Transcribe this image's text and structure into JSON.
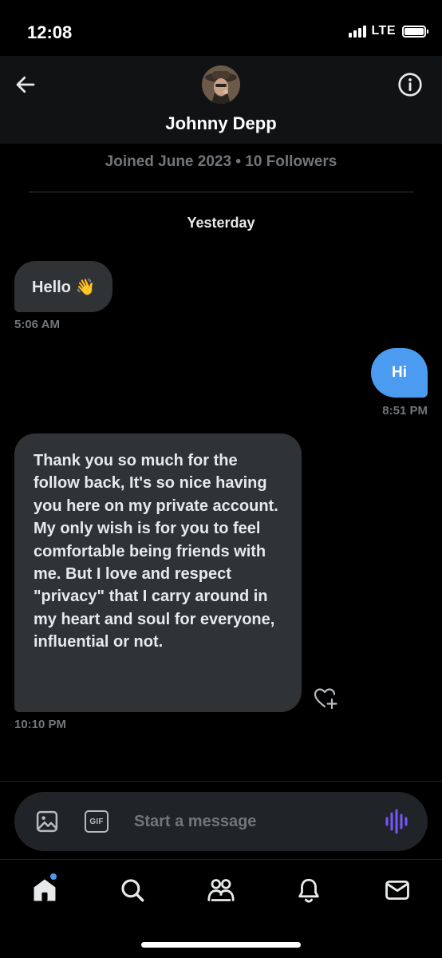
{
  "status_bar": {
    "time": "12:08",
    "network": "LTE",
    "battery_level": 1.0
  },
  "header": {
    "contact_name": "Johnny Depp",
    "meta": "Joined June 2023 • 10 Followers"
  },
  "conversation": {
    "date_separator": "Yesterday",
    "messages": [
      {
        "direction": "incoming",
        "text": "Hello 👋",
        "time": "5:06 AM"
      },
      {
        "direction": "outgoing",
        "text": "Hi",
        "time": "8:51 PM"
      },
      {
        "direction": "incoming",
        "text": "Thank you so much for the follow back, It's so nice having you here on my private account. My only wish is for you to feel comfortable being friends with me. But I love and respect \"privacy\" that I carry around in my heart and soul for everyone, influential or not.",
        "time": "10:10 PM"
      }
    ]
  },
  "composer": {
    "placeholder": "Start a message",
    "gif_label": "GIF"
  },
  "tab_bar": {
    "tabs": [
      "home-icon",
      "search-icon",
      "communities-icon",
      "notifications-icon",
      "messages-icon"
    ],
    "home_has_badge": true
  },
  "colors": {
    "accent": "#4b9cf0",
    "bubble_incoming": "#2f3336",
    "voice": "#7856ff"
  }
}
